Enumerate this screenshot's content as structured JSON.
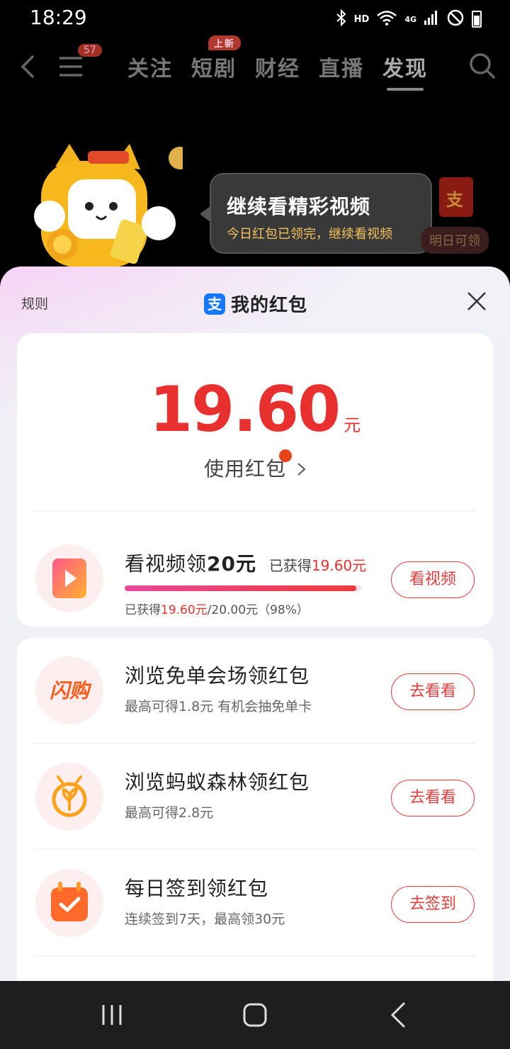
{
  "status_bar": {
    "time": "18:29",
    "hd": "HD",
    "network": "4G"
  },
  "top_nav": {
    "menu_badge": "57",
    "tabs": [
      {
        "label": "关注",
        "badge": ""
      },
      {
        "label": "短剧",
        "badge": "上新"
      },
      {
        "label": "财经",
        "badge": ""
      },
      {
        "label": "直播",
        "badge": ""
      },
      {
        "label": "发现",
        "badge": ""
      }
    ],
    "active_tab": "发现"
  },
  "promo": {
    "bubble_title": "继续看精彩视频",
    "bubble_sub": "今日红包已领完，继续看视频",
    "redpacket_glyph": "支",
    "tomorrow_label": "明日可领"
  },
  "sheet": {
    "rules_label": "规则",
    "title": "我的红包",
    "alipay_glyph": "支",
    "balance": "19.60",
    "balance_unit": "元",
    "use_label": "使用红包",
    "video_task": {
      "title_prefix": "看视频领",
      "title_amount": "20元",
      "earned_label": "已获得",
      "earned_amount": "19.60元",
      "progress_fraction": 0.98,
      "progress_earned_label": "已获得",
      "progress_earned": "19.60元",
      "progress_total": "/20.00元（98%）",
      "button": "看视频"
    },
    "tasks": [
      {
        "title": "浏览免单会场领红包",
        "subtitle": "最高可得1.8元 有机会抽免单卡",
        "button": "去看看",
        "icon": "flash-buy-icon",
        "icon_text": "闪购"
      },
      {
        "title": "浏览蚂蚁森林领红包",
        "subtitle": "最高可得2.8元",
        "button": "去看看",
        "icon": "ant-forest-icon"
      },
      {
        "title": "每日签到领红包",
        "subtitle": "连续签到7天，最高领30元",
        "button": "去签到",
        "icon": "calendar-check-icon"
      }
    ]
  },
  "colors": {
    "accent_red": "#e8302e",
    "alipay_blue": "#1677ff",
    "bubble_sub": "#f5c15a"
  }
}
